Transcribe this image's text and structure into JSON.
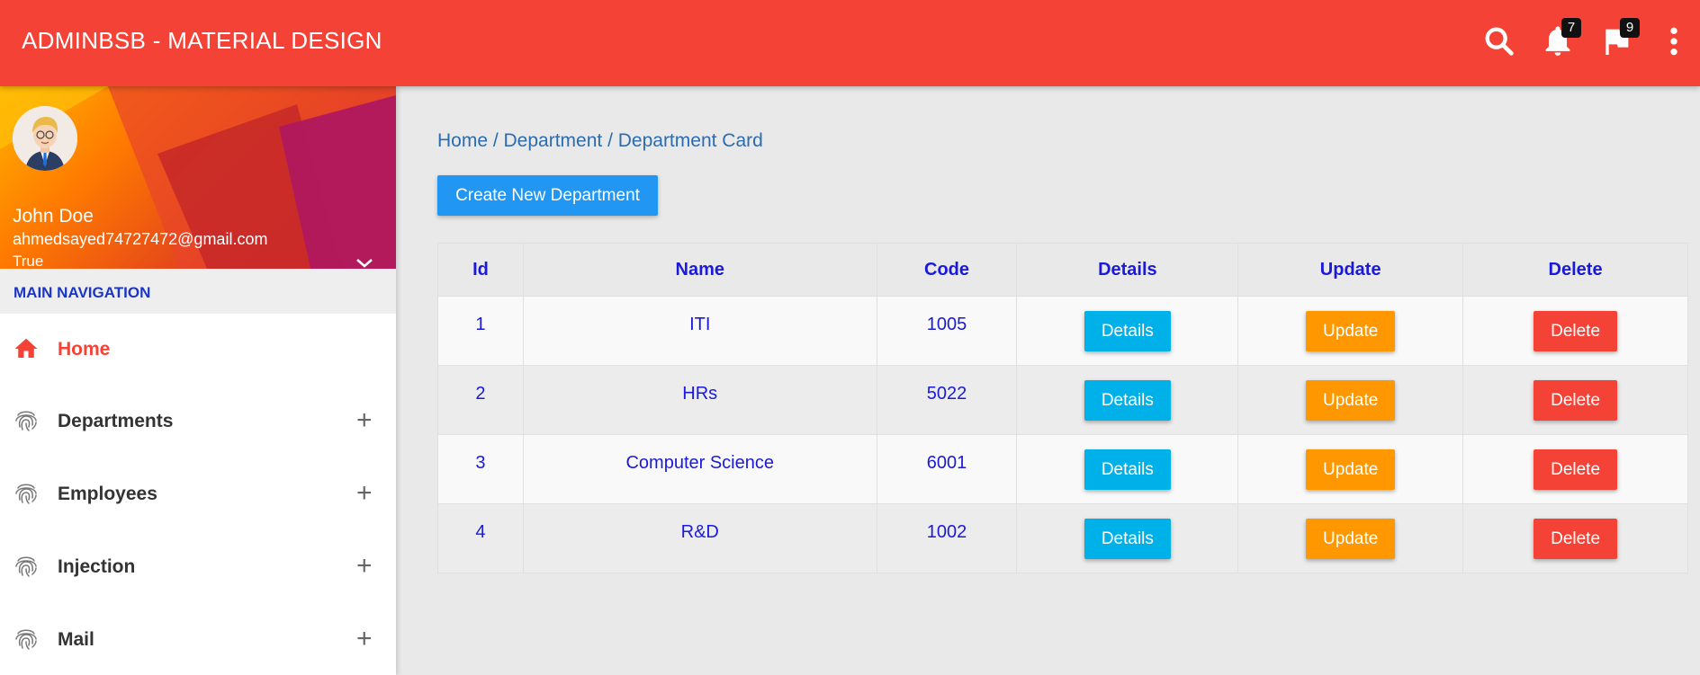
{
  "topbar": {
    "brand": "ADMINBSB - MATERIAL DESIGN",
    "bg_color": "#f44336",
    "icons": {
      "search": "search-icon",
      "notifications": "bell-icon",
      "flags": "flag-icon",
      "more": "more-vertical-icon"
    },
    "notifications_count": "7",
    "flags_count": "9"
  },
  "sidebar": {
    "user": {
      "name": "John Doe",
      "email": "ahmedsayed74727472@gmail.com",
      "extra": "True"
    },
    "nav_header": "MAIN NAVIGATION",
    "items": [
      {
        "label": "Home",
        "icon": "home-icon",
        "active": true
      },
      {
        "label": "Departments",
        "icon": "fingerprint-icon",
        "expandable": true
      },
      {
        "label": "Employees",
        "icon": "fingerprint-icon",
        "expandable": true
      },
      {
        "label": "Injection",
        "icon": "fingerprint-icon",
        "expandable": true
      },
      {
        "label": "Mail",
        "icon": "fingerprint-icon",
        "expandable": true
      }
    ],
    "expand_symbol": "+"
  },
  "main": {
    "breadcrumb": "Home / Department / Department Card",
    "create_button": "Create New Department",
    "table": {
      "headers": [
        "Id",
        "Name",
        "Code",
        "Details",
        "Update",
        "Delete"
      ],
      "rows": [
        {
          "id": "1",
          "name": "ITI",
          "code": "1005"
        },
        {
          "id": "2",
          "name": "HRs",
          "code": "5022"
        },
        {
          "id": "3",
          "name": "Computer Science",
          "code": "6001"
        },
        {
          "id": "4",
          "name": "R&D",
          "code": "1002"
        }
      ],
      "details_label": "Details",
      "update_label": "Update",
      "delete_label": "Delete"
    }
  },
  "colors": {
    "accent": "#f44336",
    "primary_button": "#2196f3",
    "details": "#00b0e8",
    "update": "#ff9800",
    "delete": "#f44336",
    "table_text": "#1a1ad8"
  }
}
